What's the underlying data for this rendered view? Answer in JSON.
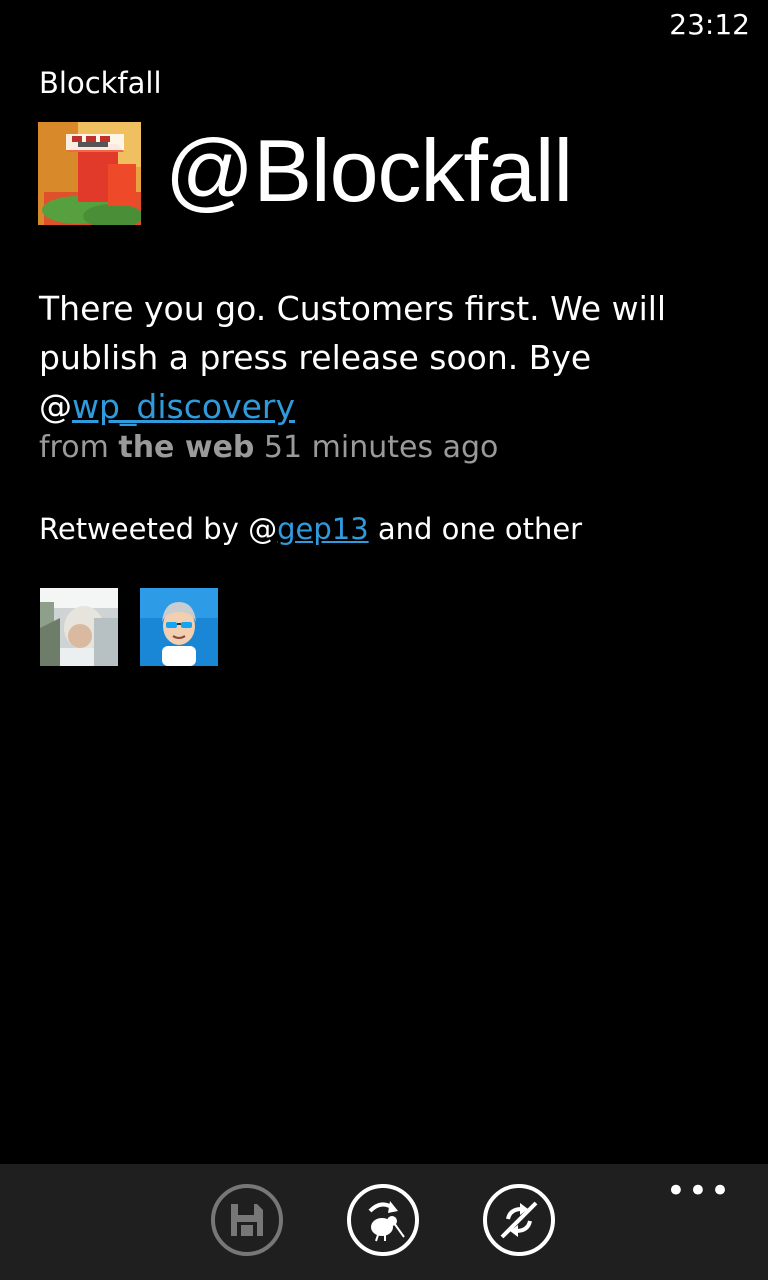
{
  "status_bar": {
    "time": "23:12"
  },
  "app": {
    "title": "Blockfall"
  },
  "profile": {
    "handle": "@Blockfall",
    "avatar_alt": "Blockfall logo"
  },
  "tweet": {
    "text_before": "There you go. Customers first. We will publish a press release soon. Bye @",
    "mention": "wp_discovery",
    "meta_from": "from ",
    "meta_source": "the web",
    "meta_time": " 51 minutes ago"
  },
  "retweet": {
    "prefix": "Retweeted by @",
    "user": "gep13",
    "suffix": " and one other"
  },
  "app_bar": {
    "buttons": [
      {
        "icon": "save-icon",
        "enabled": false
      },
      {
        "icon": "retweet-icon",
        "enabled": true
      },
      {
        "icon": "no-reply-icon",
        "enabled": true
      }
    ],
    "more_label": "•••"
  },
  "colors": {
    "accent": "#2f9bdc",
    "background": "#000000",
    "app_bar": "#1f1f1f",
    "muted_text": "#9a9a9a"
  }
}
